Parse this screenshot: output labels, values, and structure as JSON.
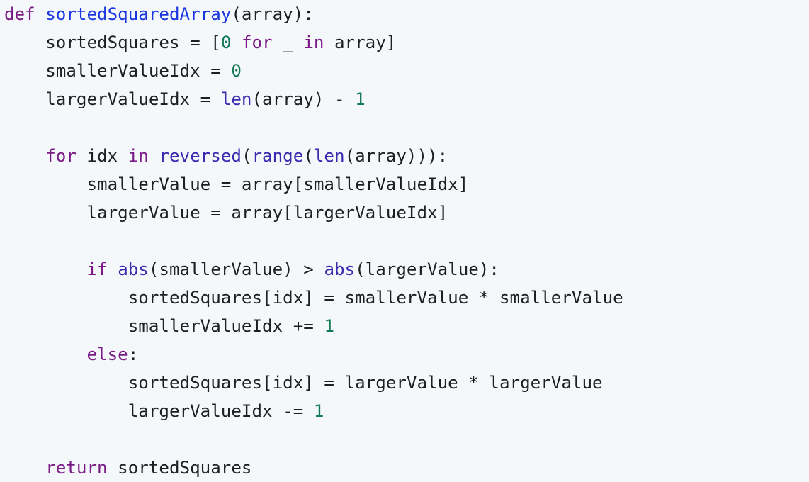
{
  "colors": {
    "background": "#f5f8fb",
    "plain": "#1f1f1f",
    "keyword": "#7a1a86",
    "function_name": "#1a36e0",
    "builtin": "#3a2ab0",
    "number": "#137a55"
  },
  "code": {
    "language": "python",
    "lines": [
      {
        "tokens": [
          {
            "t": "def",
            "k": "kw"
          },
          {
            "t": " ",
            "k": "plain"
          },
          {
            "t": "sortedSquaredArray",
            "k": "fn"
          },
          {
            "t": "(array):",
            "k": "plain"
          }
        ]
      },
      {
        "tokens": [
          {
            "t": "    sortedSquares = [",
            "k": "plain"
          },
          {
            "t": "0",
            "k": "num"
          },
          {
            "t": " ",
            "k": "plain"
          },
          {
            "t": "for",
            "k": "kw"
          },
          {
            "t": " _ ",
            "k": "plain"
          },
          {
            "t": "in",
            "k": "kw"
          },
          {
            "t": " array]",
            "k": "plain"
          }
        ]
      },
      {
        "tokens": [
          {
            "t": "    smallerValueIdx = ",
            "k": "plain"
          },
          {
            "t": "0",
            "k": "num"
          }
        ]
      },
      {
        "tokens": [
          {
            "t": "    largerValueIdx = ",
            "k": "plain"
          },
          {
            "t": "len",
            "k": "builtin"
          },
          {
            "t": "(array) - ",
            "k": "plain"
          },
          {
            "t": "1",
            "k": "num"
          }
        ]
      },
      {
        "tokens": []
      },
      {
        "tokens": [
          {
            "t": "    ",
            "k": "plain"
          },
          {
            "t": "for",
            "k": "kw"
          },
          {
            "t": " idx ",
            "k": "plain"
          },
          {
            "t": "in",
            "k": "kw"
          },
          {
            "t": " ",
            "k": "plain"
          },
          {
            "t": "reversed",
            "k": "builtin"
          },
          {
            "t": "(",
            "k": "plain"
          },
          {
            "t": "range",
            "k": "builtin"
          },
          {
            "t": "(",
            "k": "plain"
          },
          {
            "t": "len",
            "k": "builtin"
          },
          {
            "t": "(array))):",
            "k": "plain"
          }
        ]
      },
      {
        "tokens": [
          {
            "t": "        smallerValue = array[smallerValueIdx]",
            "k": "plain"
          }
        ]
      },
      {
        "tokens": [
          {
            "t": "        largerValue = array[largerValueIdx]",
            "k": "plain"
          }
        ]
      },
      {
        "tokens": []
      },
      {
        "tokens": [
          {
            "t": "        ",
            "k": "plain"
          },
          {
            "t": "if",
            "k": "kw"
          },
          {
            "t": " ",
            "k": "plain"
          },
          {
            "t": "abs",
            "k": "builtin"
          },
          {
            "t": "(smallerValue) > ",
            "k": "plain"
          },
          {
            "t": "abs",
            "k": "builtin"
          },
          {
            "t": "(largerValue):",
            "k": "plain"
          }
        ]
      },
      {
        "tokens": [
          {
            "t": "            sortedSquares[idx] = smallerValue * smallerValue",
            "k": "plain"
          }
        ]
      },
      {
        "tokens": [
          {
            "t": "            smallerValueIdx += ",
            "k": "plain"
          },
          {
            "t": "1",
            "k": "num"
          }
        ]
      },
      {
        "tokens": [
          {
            "t": "        ",
            "k": "plain"
          },
          {
            "t": "else",
            "k": "kw"
          },
          {
            "t": ":",
            "k": "plain"
          }
        ]
      },
      {
        "tokens": [
          {
            "t": "            sortedSquares[idx] = largerValue * largerValue",
            "k": "plain"
          }
        ]
      },
      {
        "tokens": [
          {
            "t": "            largerValueIdx -= ",
            "k": "plain"
          },
          {
            "t": "1",
            "k": "num"
          }
        ]
      },
      {
        "tokens": []
      },
      {
        "tokens": [
          {
            "t": "    ",
            "k": "plain"
          },
          {
            "t": "return",
            "k": "kw"
          },
          {
            "t": " sortedSquares",
            "k": "plain"
          }
        ]
      }
    ]
  }
}
